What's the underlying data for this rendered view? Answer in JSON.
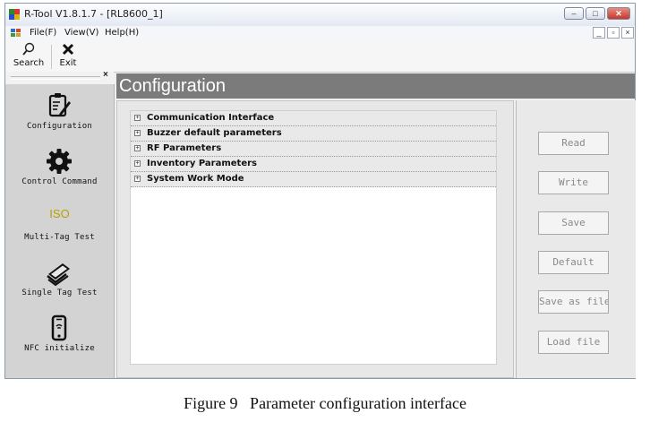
{
  "window": {
    "title": "R-Tool V1.8.1.7 - [RL8600_1]",
    "controls": {
      "minimize": "–",
      "maximize": "□",
      "close": "✕"
    },
    "mdi_controls": {
      "minimize": "_",
      "restore": "▫",
      "close": "×"
    }
  },
  "menu": {
    "items": [
      {
        "label": "File(F)"
      },
      {
        "label": "View(V)"
      },
      {
        "label": "Help(H)"
      }
    ]
  },
  "toolbar": {
    "search": {
      "label": "Search",
      "icon": "search-icon"
    },
    "exit": {
      "label": "Exit",
      "icon": "close-icon"
    }
  },
  "left_panel": {
    "close": "×",
    "items": [
      {
        "label": "Configuration",
        "icon": "clipboard-pencil-icon"
      },
      {
        "label": "Control Command",
        "icon": "gear-icon"
      },
      {
        "label": "Multi-Tag Test",
        "icon_text": "ISO"
      },
      {
        "label": "Single Tag Test",
        "icon": "card-hand-icon"
      },
      {
        "label": "NFC initialize",
        "icon": "phone-icon"
      }
    ]
  },
  "main": {
    "title": "Configuration",
    "tree": [
      {
        "label": "Communication Interface",
        "expander": "+"
      },
      {
        "label": "Buzzer default parameters",
        "expander": "+"
      },
      {
        "label": "RF Parameters",
        "expander": "+"
      },
      {
        "label": "Inventory Parameters",
        "expander": "+"
      },
      {
        "label": "System Work Mode",
        "expander": "+"
      }
    ]
  },
  "actions": {
    "read": "Read",
    "write": "Write",
    "save": "Save",
    "default": "Default",
    "save_as_file": "Save as file",
    "load_file": "Load file"
  },
  "caption": "Figure 9   Parameter configuration interface",
  "colors": {
    "header_bg": "#7b7b7b",
    "nav_bg": "#d3d3d3",
    "iso_text": "#b8a100",
    "disabled_text": "#8a8a8a"
  }
}
